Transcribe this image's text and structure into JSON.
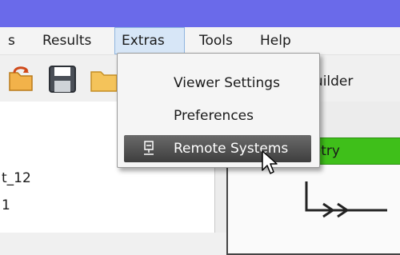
{
  "menubar": {
    "items": [
      {
        "label": "s"
      },
      {
        "label": "Results"
      },
      {
        "label": "Extras"
      },
      {
        "label": "Tools"
      },
      {
        "label": "Help"
      }
    ]
  },
  "toolbar": {
    "partial_label": "ılar Builder"
  },
  "tree": {
    "items": [
      {
        "label": "t_12"
      },
      {
        "label": "1"
      }
    ]
  },
  "workflow": {
    "node_label": "netry"
  },
  "extras_menu": {
    "items": [
      {
        "label": "Viewer Settings"
      },
      {
        "label": "Preferences"
      },
      {
        "label": "Remote Systems"
      }
    ],
    "selected": "Remote Systems"
  },
  "colors": {
    "titlebar": "#6a6aea",
    "menu_active": "#d7e6f7",
    "node_green": "#3fbf1a",
    "selected_item": "#4e4e4e"
  }
}
